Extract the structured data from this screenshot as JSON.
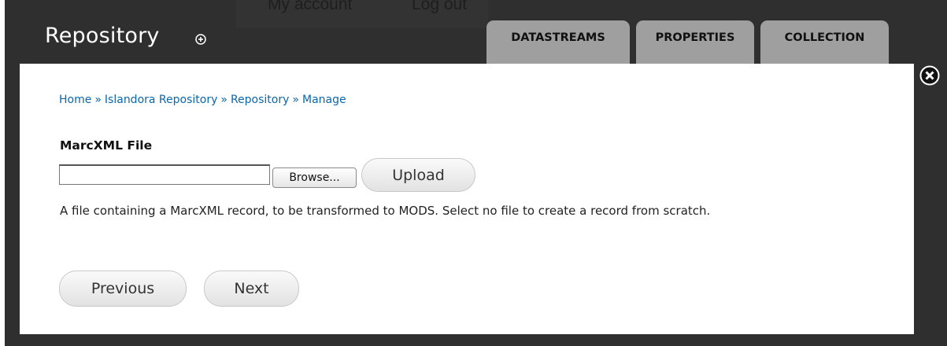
{
  "header": {
    "top_links": [
      {
        "label": "My account"
      },
      {
        "label": "Log out"
      }
    ],
    "site_title": "Repository"
  },
  "tabs": [
    {
      "label": "DATASTREAMS"
    },
    {
      "label": "PROPERTIES"
    },
    {
      "label": "COLLECTION"
    }
  ],
  "breadcrumb": {
    "items": [
      {
        "label": "Home"
      },
      {
        "label": "Islandora Repository"
      },
      {
        "label": "Repository"
      },
      {
        "label": "Manage"
      }
    ],
    "separator": "»"
  },
  "form": {
    "field_label": "MarcXML File",
    "file_input_value": "",
    "browse_label": "Browse...",
    "upload_label": "Upload",
    "description": "A file containing a MarcXML record, to be transformed to MODS. Select no file to create a record from scratch.",
    "previous_label": "Previous",
    "next_label": "Next"
  },
  "icons": {
    "plus": "plus-circle-icon",
    "close": "close-circle-icon"
  },
  "colors": {
    "header_bg": "#2f2f2f",
    "tab_bg": "#9f9f9f",
    "link": "#0b66aa"
  }
}
